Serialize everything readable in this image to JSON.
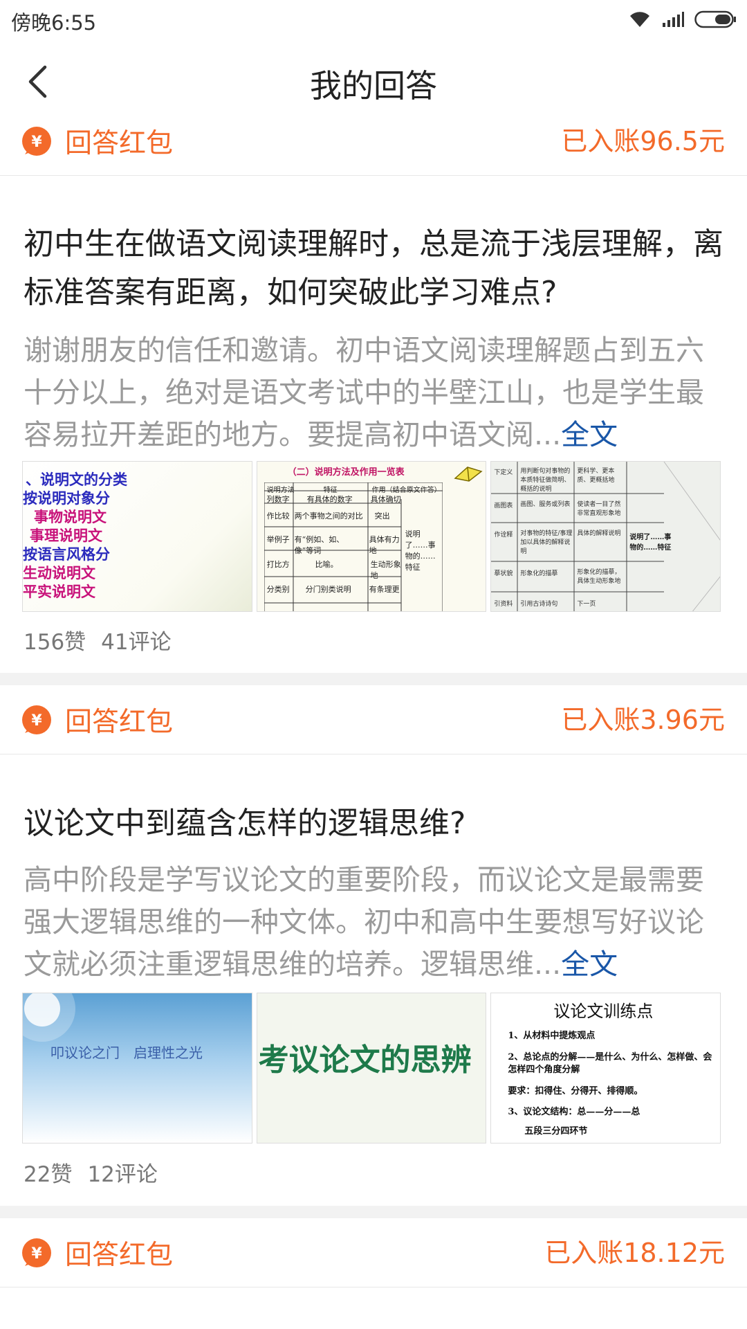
{
  "status_bar": {
    "time": "傍晚6:55"
  },
  "nav": {
    "title": "我的回答"
  },
  "reward_label": "回答红包",
  "rewards": [
    {
      "amount": "已入账96.5元"
    },
    {
      "amount": "已入账3.96元"
    },
    {
      "amount": "已入账18.12元"
    }
  ],
  "full_text_label": "全文",
  "answers": [
    {
      "title": "初中生在做语文阅读理解时，总是流于浅层理解，离标准答案有距离，如何突破此学习难点?",
      "excerpt": "谢谢朋友的信任和邀请。初中语文阅读理解题占到五六十分以上，绝对是语文考试中的半壁江山，也是学生最容易拉开差距的地方。要提高初中语文阅...",
      "likes": "156赞",
      "comments": "41评论",
      "thumbs": [
        {
          "lines": [
            "、说明文的分类",
            "按说明对象分",
            "事物说明文",
            "事理说明文",
            "按语言风格分",
            "生动说明文",
            "平实说明文"
          ]
        },
        {
          "heading": "（二）说明方法及作用一览表",
          "headers": [
            "说明方法",
            "特征",
            "作用（结合原文作答）"
          ],
          "rows": [
            [
              "列数字",
              "有具体的数字",
              "具体确切"
            ],
            [
              "作比较",
              "两个事物之间的对比",
              "突出"
            ],
            [
              "举例子",
              "有“例如、如、像”等词",
              "具体有力地"
            ],
            [
              "打比方",
              "比喻。",
              "生动形象地"
            ],
            [
              "分类别",
              "分门别类说明",
              "有条理更"
            ]
          ],
          "side_note": "说明了……事物的……特征"
        },
        {
          "rows": [
            [
              "下定义",
              "用判断句对事物的本质特征做简明、概括的说明",
              "更科学、更本质、更概括地"
            ],
            [
              "画图表",
              "画图、服务或列表",
              "使读者一目了然非常直观形象地"
            ],
            [
              "作诠释",
              "对事物的特征/事理加以具体的解释说明",
              "具体的解释说明"
            ],
            [
              "摹状貌",
              "形象化的描摹",
              "形象化的描摹，具体生动形象地"
            ],
            [
              "引资料",
              "引用古诗诗句",
              "下一页"
            ]
          ],
          "side_note": "说明了……事物的……特征"
        }
      ]
    },
    {
      "title": "议论文中到蕴含怎样的逻辑思维?",
      "excerpt": "高中阶段是学写议论文的重要阶段，而议论文是最需要强大逻辑思维的一种文体。初中和高中生要想写好议论文就必须注重逻辑思维的培养。逻辑思维...",
      "likes": "22赞",
      "comments": "12评论",
      "thumbs": [
        {
          "text": "叩议论之门　启理性之光"
        },
        {
          "text": "考议论文的思辨"
        },
        {
          "heading": "议论文训练点",
          "lines": [
            "1、从材料中提炼观点",
            "2、总论点的分解——是什么、为什么、怎样做、会怎样四个角度分解",
            "要求：扣得住、分得开、排得顺。",
            "3、议论文结构：总——分——总",
            "五段三分四环节"
          ]
        }
      ]
    }
  ],
  "colors": {
    "accent": "#f36a2a",
    "link": "#1a57a8",
    "excerpt": "#9a9a9a"
  }
}
